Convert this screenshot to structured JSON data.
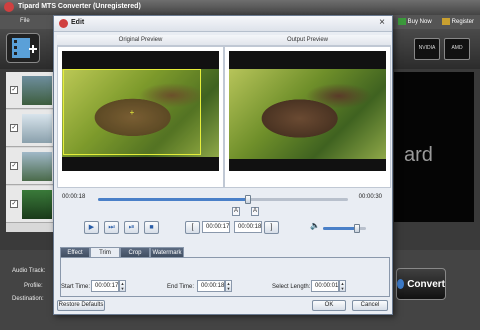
{
  "app": {
    "title": "Tipard MTS Converter (Unregistered)",
    "menu_file": "File",
    "buy_now": "Buy Now",
    "register": "Register",
    "brand_chips": [
      "NVIDIA",
      "AMD"
    ],
    "right_preview_text": "ard",
    "audio_track_label": "Audio Track:",
    "profile_label": "Profile:",
    "destination_label": "Destination:",
    "convert_label": "Convert",
    "merge_label": "M"
  },
  "dialog": {
    "title": "Edit",
    "close_glyph": "×",
    "original_preview": "Original Preview",
    "output_preview": "Output Preview",
    "timeline": {
      "start_time": "00:00:18",
      "end_time": "00:00:30",
      "progress": 0.6
    },
    "controls": {
      "play": "▶",
      "step": "⏭",
      "frame": "⏯",
      "stop": "■",
      "mark_in": "[",
      "mark_out": "]",
      "marker_a": "A",
      "marker_b": "A",
      "time_in": "00:00:17",
      "time_out": "00:00:18",
      "volume_icon": "🔈",
      "volume": 0.8
    },
    "tabs": [
      "Effect",
      "Trim",
      "Crop",
      "Watermark"
    ],
    "active_tab": "Trim",
    "trim": {
      "start_label": "Start Time:",
      "start_value": "00:00:17",
      "end_label": "End Time:",
      "end_value": "00:00:18",
      "length_label": "Select Length:",
      "length_value": "00:00:01"
    },
    "restore_defaults": "Restore Defaults",
    "ok": "OK",
    "cancel": "Cancel"
  }
}
